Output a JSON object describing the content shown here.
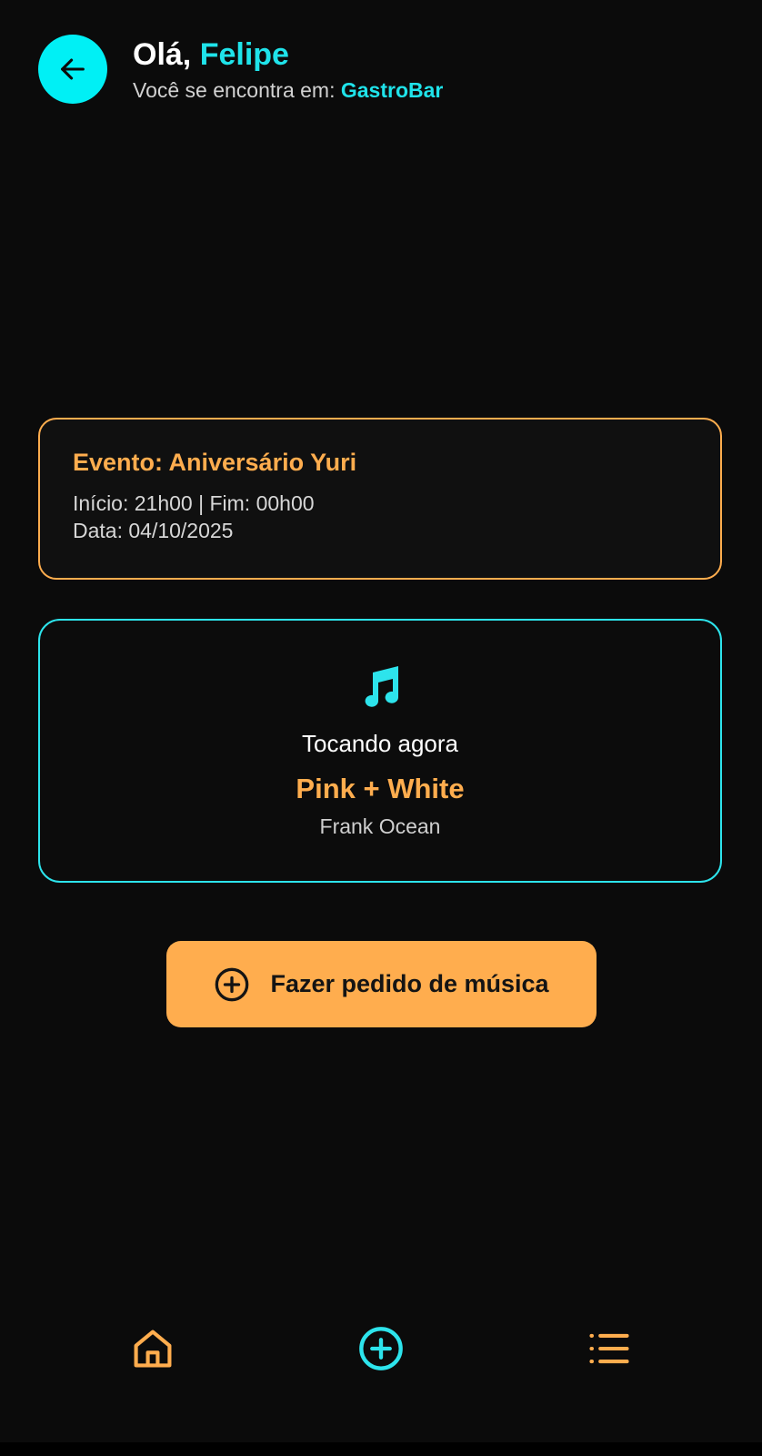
{
  "header": {
    "greeting_prefix": "Olá, ",
    "user_name": "Felipe",
    "location_prefix": "Você se encontra em: ",
    "venue_name": "GastroBar",
    "back_icon": "arrow-left-icon"
  },
  "event": {
    "title": "Evento: Aniversário Yuri",
    "schedule": "Início: 21h00 | Fim: 00h00",
    "date": "Data: 04/10/2025"
  },
  "now_playing": {
    "icon": "music-note-icon",
    "label": "Tocando agora",
    "song": "Pink + White",
    "artist": "Frank Ocean"
  },
  "request_button": {
    "icon": "plus-circle-icon",
    "label": "Fazer pedido de música"
  },
  "bottom_nav": {
    "items": [
      {
        "icon": "home-icon"
      },
      {
        "icon": "plus-circle-icon",
        "active": true
      },
      {
        "icon": "list-icon"
      }
    ]
  },
  "colors": {
    "background": "#0b0b0b",
    "accent_cyan": "#00f0f5",
    "accent_orange": "#ffad4e"
  }
}
